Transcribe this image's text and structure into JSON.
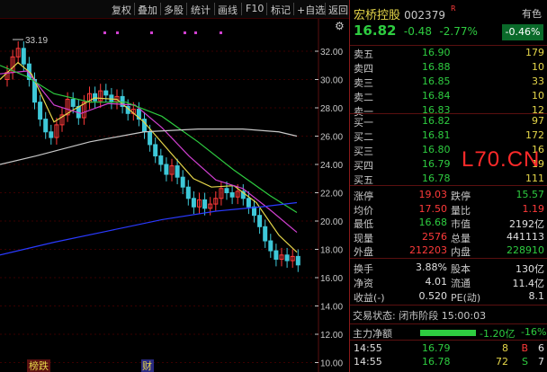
{
  "toolbar": {
    "items": [
      "复权",
      "叠加",
      "多股",
      "统计",
      "画线",
      "F10",
      "标记",
      "+自选",
      "返回"
    ],
    "right_icon": "gear-icon"
  },
  "chart": {
    "price_axis": [
      "32.00",
      "30.00",
      "28.00",
      "26.00",
      "24.00",
      "22.00",
      "20.00",
      "18.00",
      "16.00",
      "14.00",
      "12.00",
      "10.00"
    ],
    "high_label": "33.19",
    "ma_colors": {
      "ma5": "#e6d74a",
      "ma10": "#d040d0",
      "ma20": "#2ecc40",
      "ma60": "#c8c8c8",
      "ma120": "#2a3aff"
    },
    "bottom_tags": [
      "榜跌",
      "财"
    ]
  },
  "quote": {
    "name": "宏桥控股",
    "code": "002379",
    "badge": "R",
    "tag": "有色",
    "price": "16.82",
    "change": "-0.48",
    "change_pct": "-2.77%",
    "sector_pct": "-0.46%",
    "asks": [
      {
        "label": "卖五",
        "price": "16.90",
        "vol": "179"
      },
      {
        "label": "卖四",
        "price": "16.88",
        "vol": "10"
      },
      {
        "label": "卖三",
        "price": "16.85",
        "vol": "33"
      },
      {
        "label": "卖二",
        "price": "16.84",
        "vol": "10"
      },
      {
        "label": "卖一",
        "price": "16.83",
        "vol": "12"
      }
    ],
    "bids": [
      {
        "label": "买一",
        "price": "16.82",
        "vol": "97"
      },
      {
        "label": "买二",
        "price": "16.81",
        "vol": "172"
      },
      {
        "label": "买三",
        "price": "16.80",
        "vol": "16"
      },
      {
        "label": "买四",
        "price": "16.79",
        "vol": "19"
      },
      {
        "label": "买五",
        "price": "16.78",
        "vol": "111"
      }
    ],
    "watermark": "L70.CN",
    "stats": [
      [
        {
          "l": "涨停",
          "v": "19.03",
          "c": "red"
        },
        {
          "l": "跌停",
          "v": "15.57",
          "c": "green"
        }
      ],
      [
        {
          "l": "均价",
          "v": "17.50",
          "c": "red"
        },
        {
          "l": "量比",
          "v": "1.19",
          "c": "red"
        }
      ],
      [
        {
          "l": "最低",
          "v": "16.68",
          "c": "green"
        },
        {
          "l": "市值",
          "v": "2192亿",
          "c": "white"
        }
      ],
      [
        {
          "l": "现量",
          "v": "2576",
          "c": "red"
        },
        {
          "l": "总量",
          "v": "441113",
          "c": "white"
        }
      ],
      [
        {
          "l": "外盘",
          "v": "212203",
          "c": "red"
        },
        {
          "l": "内盘",
          "v": "228910",
          "c": "green"
        }
      ]
    ],
    "fund": [
      [
        {
          "l": "换手",
          "v": "3.88%"
        },
        {
          "l": "股本",
          "v": "130亿"
        }
      ],
      [
        {
          "l": "净资",
          "v": "4.01"
        },
        {
          "l": "流通",
          "v": "11.4亿"
        }
      ],
      [
        {
          "l": "收益(-)",
          "v": "0.520"
        },
        {
          "l": "PE(动)",
          "v": "8.1"
        }
      ]
    ],
    "trade_status": "交易状态: 闭市阶段 15:00:03",
    "main_flow": {
      "label": "主力净额",
      "value": "-1.20亿",
      "pct": "-16%"
    },
    "ticks": [
      {
        "time": "14:55",
        "price": "16.79",
        "vol": "8",
        "dir": "B",
        "n": "6"
      },
      {
        "time": "14:55",
        "price": "16.78",
        "vol": "72",
        "dir": "S",
        "n": "7"
      }
    ]
  }
}
